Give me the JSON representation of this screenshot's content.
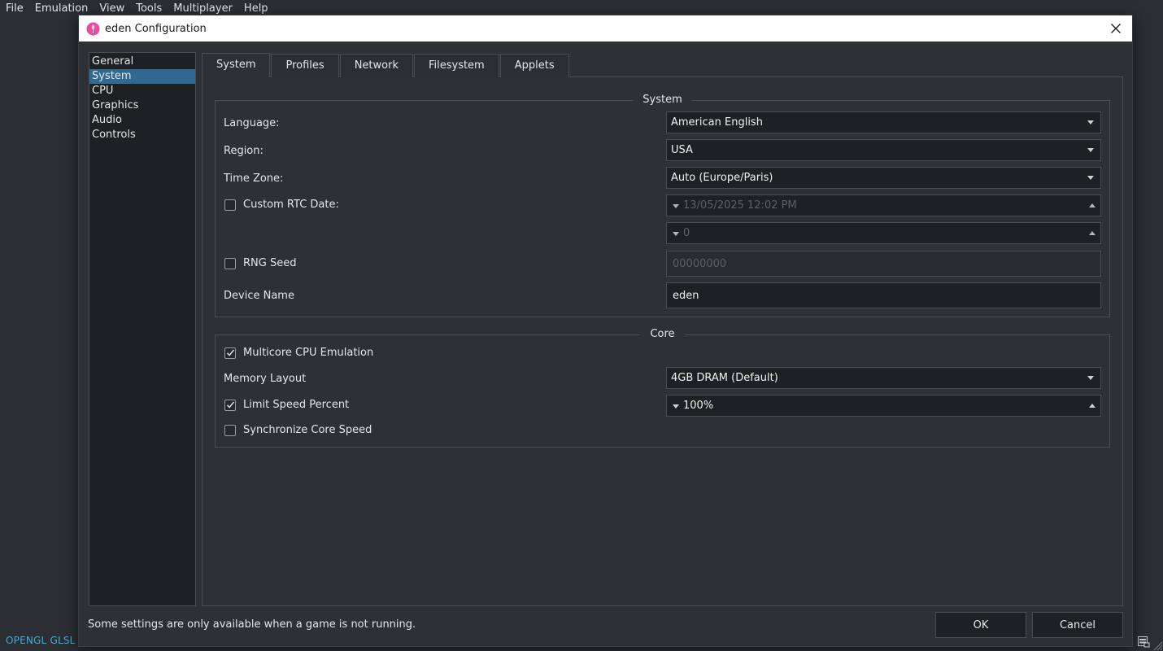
{
  "menubar": {
    "items": [
      "File",
      "Emulation",
      "View",
      "Tools",
      "Multiplayer",
      "Help"
    ]
  },
  "statusbar": {
    "renderer": "OPENGL GLSL"
  },
  "dialog": {
    "title": "eden Configuration",
    "icons": {
      "logo": "eden-logo-icon",
      "close": "close-icon"
    }
  },
  "sidebar": {
    "items": [
      {
        "label": "General",
        "active": false
      },
      {
        "label": "System",
        "active": true
      },
      {
        "label": "CPU",
        "active": false
      },
      {
        "label": "Graphics",
        "active": false
      },
      {
        "label": "Audio",
        "active": false
      },
      {
        "label": "Controls",
        "active": false
      }
    ]
  },
  "tabs": [
    "System",
    "Profiles",
    "Network",
    "Filesystem",
    "Applets"
  ],
  "system_group": {
    "title": "System",
    "language": {
      "label": "Language:",
      "value": "American English"
    },
    "region": {
      "label": "Region:",
      "value": "USA"
    },
    "timezone": {
      "label": "Time Zone:",
      "value": "Auto (Europe/Paris)"
    },
    "custom_rtc": {
      "label": "Custom RTC Date:",
      "checked": false,
      "date_value": "13/05/2025 12:02 PM",
      "offset_value": "0"
    },
    "rng_seed": {
      "label": "RNG Seed",
      "checked": false,
      "value": "00000000"
    },
    "device_name": {
      "label": "Device Name",
      "value": "eden"
    }
  },
  "core_group": {
    "title": "Core",
    "multicore": {
      "label": "Multicore CPU Emulation",
      "checked": true
    },
    "memory_layout": {
      "label": "Memory Layout",
      "value": "4GB DRAM (Default)"
    },
    "limit_speed": {
      "label": "Limit Speed Percent",
      "checked": true,
      "value": "100%"
    },
    "sync_core": {
      "label": "Synchronize Core Speed",
      "checked": false
    }
  },
  "footer": {
    "note": "Some settings are only available when a game is not running.",
    "ok_label": "OK",
    "cancel_label": "Cancel"
  },
  "colors": {
    "accent": "#2f6a92",
    "renderer_text": "#3fb0d8",
    "logo": "#e84d9a"
  }
}
